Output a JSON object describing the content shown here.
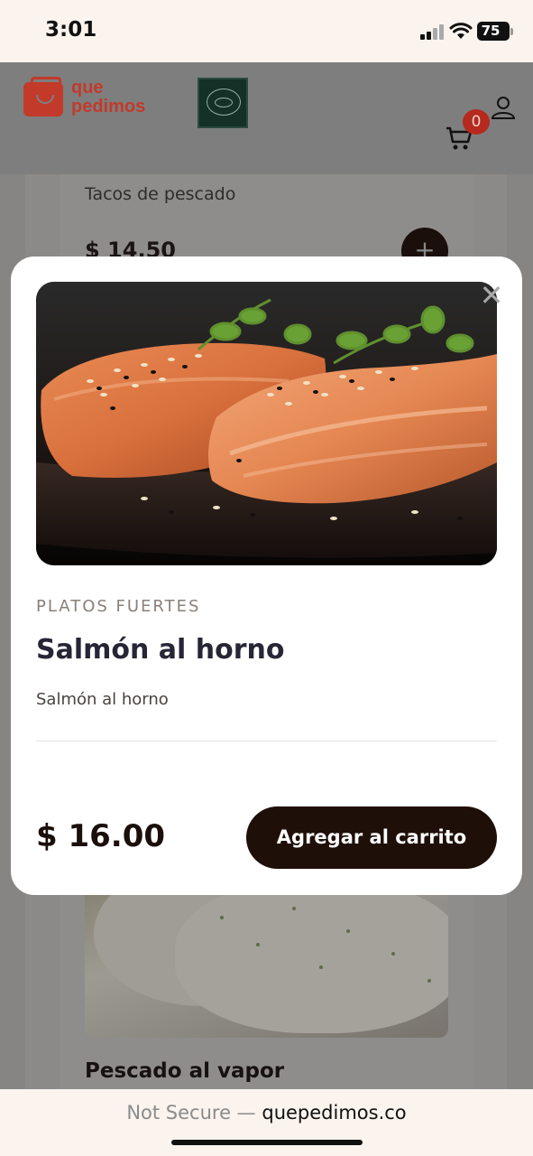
{
  "status_bar": {
    "time": "3:01",
    "battery": "75"
  },
  "header": {
    "logo_line1": "que",
    "logo_line2": "pedimos",
    "cart_count": "0"
  },
  "background_menu": {
    "item_description": "Tacos de pescado",
    "item_price": "$ 14.50",
    "add_symbol": "+",
    "next_item_title": "Pescado al vapor"
  },
  "modal": {
    "close_symbol": "✕",
    "category": "PLATOS FUERTES",
    "title": "Salmón al horno",
    "description": "Salmón al horno",
    "price": "$ 16.00",
    "add_to_cart_label": "Agregar al carrito"
  },
  "browser": {
    "security_label": "Not Secure —",
    "domain": "quepedimos.co"
  },
  "colors": {
    "brand_red": "#c23a2a",
    "button_dark": "#1f0f09",
    "badge_red": "#b5291f"
  }
}
